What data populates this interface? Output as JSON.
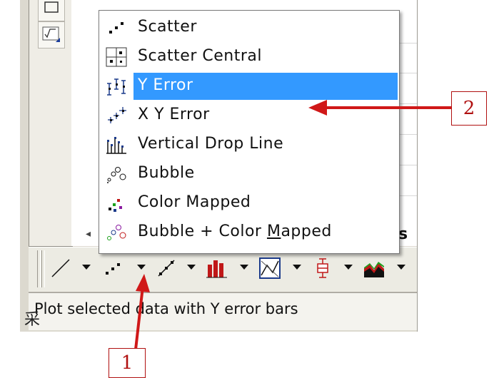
{
  "menu": {
    "items": [
      {
        "label": "Scatter",
        "icon": "scatter-icon"
      },
      {
        "label": "Scatter Central",
        "icon": "scatter-central-icon"
      },
      {
        "label": "Y Error",
        "icon": "y-error-icon",
        "selected": true
      },
      {
        "label": "X Y Error",
        "icon": "xy-error-icon"
      },
      {
        "label": "Vertical Drop Line",
        "icon": "vertical-drop-line-icon"
      },
      {
        "label": "Bubble",
        "icon": "bubble-icon"
      },
      {
        "label": "Color Mapped",
        "icon": "color-mapped-icon"
      },
      {
        "label_pre": "Bubble + Color ",
        "label_accel": "M",
        "label_post": "apped",
        "icon": "bubble-color-mapped-icon"
      }
    ]
  },
  "toolbar": {
    "buttons": [
      "line-plot-icon",
      "scatter-plot-icon",
      "line-symbol-plot-icon",
      "column-plot-icon",
      "template-plot-icon",
      "box-chart-icon",
      "area-plot-icon"
    ]
  },
  "status_bar": {
    "text": "Plot selected data with Y error bars"
  },
  "worksheet": {
    "clipped_text": "s"
  },
  "annotations": {
    "callout_1": "1",
    "callout_2": "2",
    "cjk_mark": "采"
  },
  "colors": {
    "selection": "#3399ff",
    "annotation": "#d01818"
  }
}
